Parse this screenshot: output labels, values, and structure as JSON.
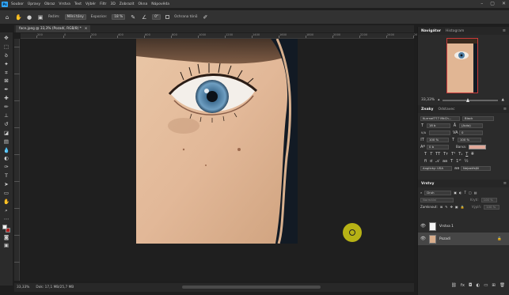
{
  "menu": {
    "items": [
      "Soubor",
      "Úpravy",
      "Obraz",
      "Vrstva",
      "Text",
      "Výběr",
      "Filtr",
      "3D",
      "Zobrazit",
      "Okna",
      "Nápověda"
    ]
  },
  "options_bar": {
    "mode_label": "Režim:",
    "mode_value": "Mění tóny",
    "exposure_label": "Expozice:",
    "exposure_value": "18 %",
    "angle_value": "0°",
    "protect_tones_label": "Ochrana tónů"
  },
  "document_tab": {
    "title": "face.jpeg @ 33,3% (Pozadí, RGB/8) *",
    "close": "×"
  },
  "ruler": {
    "top_ticks": [
      "200",
      "0",
      "200",
      "400",
      "600",
      "800",
      "1000",
      "1200",
      "1400",
      "1600",
      "1800",
      "2000",
      "2200",
      "2400",
      "2600"
    ]
  },
  "status": {
    "zoom": "33,33%",
    "doc_size": "Dok: 17,1 MB/25,7 MB"
  },
  "navigator": {
    "tab_active": "Navigátor",
    "tab_other": "Histogram",
    "zoom": "33,33%"
  },
  "character": {
    "tab_active": "Znaky",
    "tab_other": "Odstavec",
    "font_family": "Kurrnaf777 MkCh...",
    "font_style": "Black",
    "size": "18 b",
    "leading": "(Auto)",
    "kerning": "V/A",
    "tracking": "0",
    "vscale": "100 %",
    "hscale": "100 %",
    "baseline": "0 b",
    "color_label": "Barva:",
    "language": "Anglicky: USA",
    "antialias": "Nejostřejší"
  },
  "layers": {
    "tab": "Vrstvy",
    "filter_label": "Druh",
    "blend_mode": "Normální",
    "opacity_label": "Krytí:",
    "opacity": "100 %",
    "lock_label": "Zamknout:",
    "fill_label": "Výplň:",
    "fill": "100 %",
    "items": [
      {
        "name": "Vrstva 1"
      },
      {
        "name": "Pozadí"
      }
    ]
  },
  "colors": {
    "accent": "#31a8ff",
    "cursor": "#d2cd14",
    "text_color_swatch": "#e0a898"
  }
}
